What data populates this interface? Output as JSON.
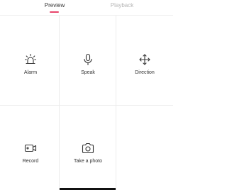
{
  "tabs": {
    "preview_label": "Preview",
    "playback_label": "Playback",
    "active": "Preview"
  },
  "controls": [
    {
      "label": "Alarm",
      "icon": "alarm-light-icon"
    },
    {
      "label": "Speak",
      "icon": "microphone-icon"
    },
    {
      "label": "Direction",
      "icon": "move-arrows-icon"
    },
    {
      "label": "Record",
      "icon": "video-camera-icon"
    },
    {
      "label": "Take a photo",
      "icon": "camera-icon"
    }
  ],
  "colors": {
    "accent": "#e8456b",
    "text": "#333333",
    "inactive_text": "#b5b5b5",
    "grid": "#ececec"
  }
}
